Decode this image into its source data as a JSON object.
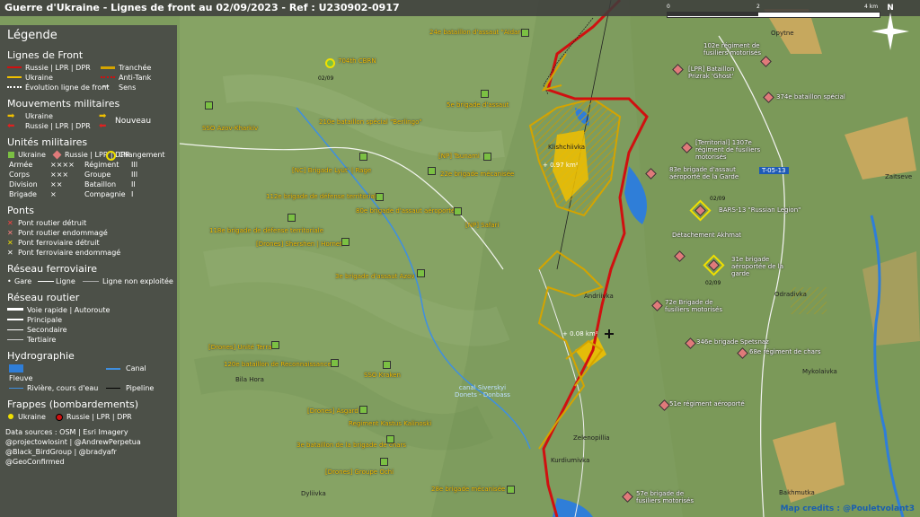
{
  "title": "Guerre d'Ukraine - Lignes de front au 02/09/2023 - Ref : U230902-0917",
  "scale": {
    "ticks": [
      "0",
      "2",
      "4 km"
    ]
  },
  "north": "N",
  "road_tag": "T-05-13",
  "map_credit": "Map credits : @Pouletvolant3",
  "legend": {
    "title": "Légende",
    "front": {
      "heading": "Lignes de Front",
      "russia": "Russie | LPR | DPR",
      "ukraine": "Ukraine",
      "evolution": "Évolution ligne de front",
      "trench": "Tranchée",
      "antitank": "Anti-Tank",
      "sens": "Sens"
    },
    "moves": {
      "heading": "Mouvements militaires",
      "ukraine": "Ukraine",
      "russia": "Russie | LPR | DPR",
      "new": "Nouveau"
    },
    "units": {
      "heading": "Unités militaires",
      "ukraine": "Ukraine",
      "russia": "Russie | LPR | DPR",
      "change": "Changement",
      "sizes": [
        [
          "Armée",
          "××××",
          "Régiment",
          "III"
        ],
        [
          "Corps",
          "×××",
          "Groupe",
          "III"
        ],
        [
          "Division",
          "××",
          "Bataillon",
          "II"
        ],
        [
          "Brigade",
          "×",
          "Compagnie",
          "I"
        ]
      ]
    },
    "bridges": {
      "heading": "Ponts",
      "items": [
        "Pont routier détruit",
        "Pont routier endommagé",
        "Pont ferroviaire détruit",
        "Pont ferroviaire endommagé"
      ]
    },
    "rail": {
      "heading": "Réseau ferroviaire",
      "gare": "Gare",
      "ligne": "Ligne",
      "unused": "Ligne non exploitée"
    },
    "road": {
      "heading": "Réseau routier",
      "items": [
        "Voie rapide | Autoroute",
        "Principale",
        "Secondaire",
        "Tertiaire"
      ]
    },
    "hydro": {
      "heading": "Hydrographie",
      "fleuve": "Fleuve",
      "canal": "Canal",
      "river": "Rivière, cours d'eau",
      "pipeline": "Pipeline"
    },
    "strikes": {
      "heading": "Frappes (bombardements)",
      "ukraine": "Ukraine",
      "russia": "Russie | LPR | DPR"
    },
    "sources": [
      "Data sources : OSM | Esri Imagery",
      "@projectowlosint | @AndrewPerpetua",
      "@Black_BirdGroup | @bradyafr",
      "@GeoConfirmed"
    ]
  },
  "ua_units": [
    {
      "name": "24e bataillon d'assaut \"Aidar\""
    },
    {
      "name": "704th CBRN"
    },
    {
      "name": "5e brigade d'assaut"
    },
    {
      "name": "210e bataillon spécial \"Berlingo\""
    },
    {
      "name": "SSO Azov-Kharkiv"
    },
    {
      "name": "[NP] Tsunami"
    },
    {
      "name": "22e brigade mécanisée"
    },
    {
      "name": "[NC] Brigade Lyut' | Rage"
    },
    {
      "name": "112e brigade de défense territoriale"
    },
    {
      "name": "80e brigade d'assaut aéroporté"
    },
    {
      "name": "[NP] Safari"
    },
    {
      "name": "118e brigade de défense territoriale"
    },
    {
      "name": "[Drones] Shershen | Hornet"
    },
    {
      "name": "3e brigade d'assaut Azov"
    },
    {
      "name": "[Drones] Unité Terra"
    },
    {
      "name": "120e bataillon de Reconnaissance"
    },
    {
      "name": "SSO Kraken"
    },
    {
      "name": "[Drones] Asgard"
    },
    {
      "name": "Regiment Kastus Kalinoski"
    },
    {
      "name": "3e bataillon de la brigade de chars"
    },
    {
      "name": "[Drones] Groupe Ochi"
    },
    {
      "name": "28e brigade mécanisée"
    }
  ],
  "ru_units": [
    {
      "name": "102e régiment de fusiliers motorisés"
    },
    {
      "name": "[LPR] Bataillon Prizrak 'Ghost'"
    },
    {
      "name": "374e bataillon spécial"
    },
    {
      "name": "[Territorial] 1307e régiment de fusiliers motorisés"
    },
    {
      "name": "83e brigade d'assaut aéroporté de la Garde"
    },
    {
      "name": "BARS-13 \"Russian Legion\""
    },
    {
      "name": "Détachement Akhmat"
    },
    {
      "name": "31e brigade aéroportée de la garde"
    },
    {
      "name": "72e Brigade de fusiliers motorisés"
    },
    {
      "name": "346e brigade Spetsnaz"
    },
    {
      "name": "68e régiment de chars"
    },
    {
      "name": "51e régiment aéroporté"
    },
    {
      "name": "57e brigade de fusiliers motorisés"
    }
  ],
  "dates": [
    "02/09",
    "02/09",
    "02/09"
  ],
  "places": [
    "Klishchiivka",
    "Andriivka",
    "Zelenopillia",
    "Kurdiumivka",
    "Bila Hora",
    "Dyliivka",
    "Opytne",
    "Zaitseve",
    "Odradivka",
    "Mykolaivka",
    "Bakhmutka"
  ],
  "areas": [
    "+ 0.97 km²",
    "+ 0.08 km²"
  ],
  "canal": "canal Siverskyi Donets - Donbass",
  "colors": {
    "russia": "#d01010",
    "ukraine": "#f0c000",
    "legend_bg": "#464646"
  }
}
